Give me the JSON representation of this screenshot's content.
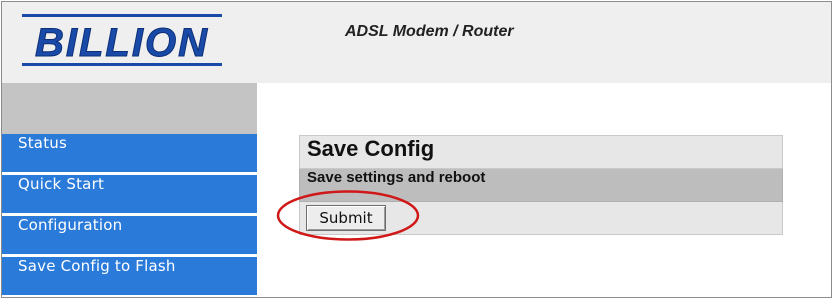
{
  "header": {
    "logo_text": "BILLION",
    "device_title": "ADSL Modem / Router",
    "logo_color": "#1a4aa8"
  },
  "sidebar": {
    "items": [
      {
        "label": "Status"
      },
      {
        "label": "Quick Start"
      },
      {
        "label": "Configuration"
      },
      {
        "label": "Save Config to Flash"
      }
    ],
    "item_color": "#2a7ad9"
  },
  "main": {
    "panel_title": "Save Config",
    "panel_subtitle": "Save settings and reboot",
    "submit_label": "Submit"
  },
  "annotation": {
    "highlight": "red-ellipse",
    "color": "#d01818"
  }
}
